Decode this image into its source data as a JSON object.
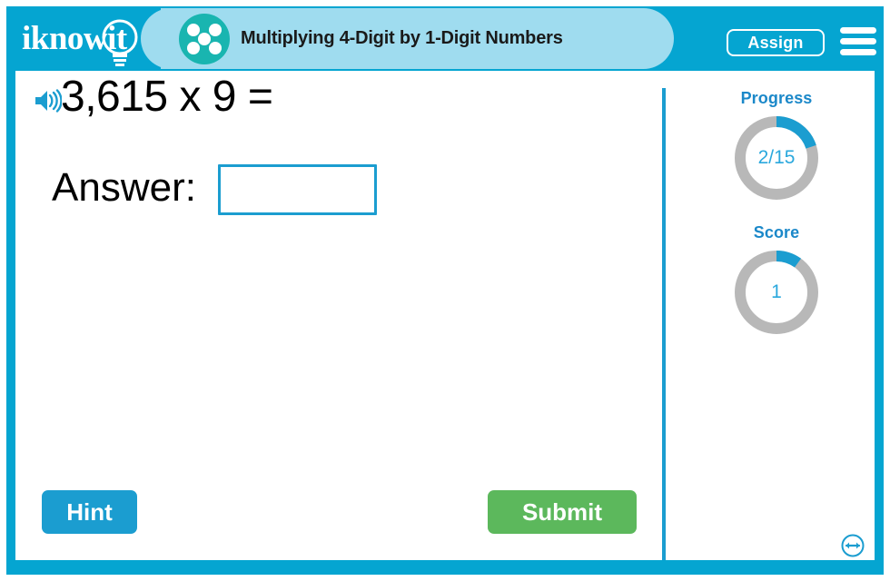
{
  "app": {
    "brand": "iknowit",
    "frame_color": "#05a5d1",
    "accent_color": "#1b9dd0",
    "pill_color": "#9fdcef"
  },
  "header": {
    "logo_text": "iknowit",
    "logo_icon": "lightbulb-icon",
    "lesson_icon": "five-dots-circle-icon",
    "lesson_title": "Multiplying 4-Digit by 1-Digit Numbers",
    "assign_label": "Assign",
    "menu_icon": "hamburger-menu-icon"
  },
  "question": {
    "audio_icon": "speaker-icon",
    "text": "3,615 x 9 =",
    "answer_label": "Answer:",
    "answer_value": "",
    "answer_placeholder": ""
  },
  "stats": {
    "progress": {
      "label": "Progress",
      "value_text": "2/15",
      "current": 2,
      "total": 15,
      "arc_percent": 20,
      "arc_color": "#1b9dd0",
      "track_color": "#b8b8b8"
    },
    "score": {
      "label": "Score",
      "value_text": "1",
      "current": 1,
      "arc_percent": 10,
      "arc_color": "#1b9dd0",
      "track_color": "#b8b8b8"
    }
  },
  "footer": {
    "hint_label": "Hint",
    "submit_label": "Submit",
    "resize_icon": "resize-horizontal-icon"
  }
}
